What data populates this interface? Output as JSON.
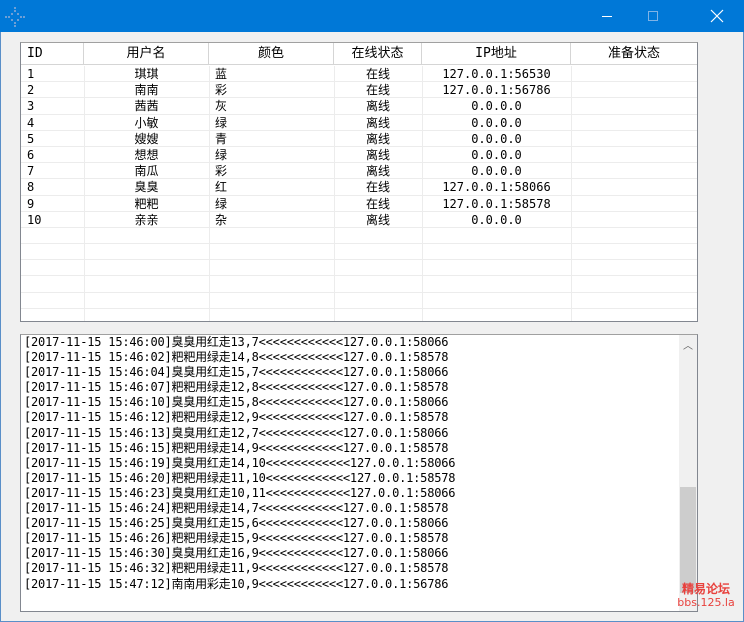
{
  "window": {
    "minimize_glyph": "—",
    "maximize_glyph": "☐",
    "close_glyph": "✕",
    "accent_color": "#0078d7"
  },
  "table": {
    "columns": [
      "ID",
      "用户名",
      "颜色",
      "在线状态",
      "IP地址",
      "准备状态"
    ],
    "rows": [
      {
        "id": "1",
        "user": "琪琪",
        "color": "蓝",
        "status": "在线",
        "ip": "127.0.0.1:56530",
        "ready": ""
      },
      {
        "id": "2",
        "user": "南南",
        "color": "彩",
        "status": "在线",
        "ip": "127.0.0.1:56786",
        "ready": ""
      },
      {
        "id": "3",
        "user": "茜茜",
        "color": "灰",
        "status": "离线",
        "ip": "0.0.0.0",
        "ready": ""
      },
      {
        "id": "4",
        "user": "小敏",
        "color": "绿",
        "status": "离线",
        "ip": "0.0.0.0",
        "ready": ""
      },
      {
        "id": "5",
        "user": "嫂嫂",
        "color": "青",
        "status": "离线",
        "ip": "0.0.0.0",
        "ready": ""
      },
      {
        "id": "6",
        "user": "想想",
        "color": "绿",
        "status": "离线",
        "ip": "0.0.0.0",
        "ready": ""
      },
      {
        "id": "7",
        "user": "南瓜",
        "color": "彩",
        "status": "离线",
        "ip": "0.0.0.0",
        "ready": ""
      },
      {
        "id": "8",
        "user": "臭臭",
        "color": "红",
        "status": "在线",
        "ip": "127.0.0.1:58066",
        "ready": ""
      },
      {
        "id": "9",
        "user": "粑粑",
        "color": "绿",
        "status": "在线",
        "ip": "127.0.0.1:58578",
        "ready": ""
      },
      {
        "id": "10",
        "user": "亲亲",
        "color": "杂",
        "status": "离线",
        "ip": "0.0.0.0",
        "ready": ""
      }
    ]
  },
  "log": {
    "lines": [
      "[2017-11-15 15:46:00]臭臭用红走13,7<<<<<<<<<<<<127.0.0.1:58066",
      "[2017-11-15 15:46:02]粑粑用绿走14,8<<<<<<<<<<<<127.0.0.1:58578",
      "[2017-11-15 15:46:04]臭臭用红走15,7<<<<<<<<<<<<127.0.0.1:58066",
      "[2017-11-15 15:46:07]粑粑用绿走12,8<<<<<<<<<<<<127.0.0.1:58578",
      "[2017-11-15 15:46:10]臭臭用红走15,8<<<<<<<<<<<<127.0.0.1:58066",
      "[2017-11-15 15:46:12]粑粑用绿走12,9<<<<<<<<<<<<127.0.0.1:58578",
      "[2017-11-15 15:46:13]臭臭用红走12,7<<<<<<<<<<<<127.0.0.1:58066",
      "[2017-11-15 15:46:15]粑粑用绿走14,9<<<<<<<<<<<<127.0.0.1:58578",
      "[2017-11-15 15:46:19]臭臭用红走14,10<<<<<<<<<<<<127.0.0.1:58066",
      "[2017-11-15 15:46:20]粑粑用绿走11,10<<<<<<<<<<<<127.0.0.1:58578",
      "[2017-11-15 15:46:23]臭臭用红走10,11<<<<<<<<<<<<127.0.0.1:58066",
      "[2017-11-15 15:46:24]粑粑用绿走14,7<<<<<<<<<<<<127.0.0.1:58578",
      "[2017-11-15 15:46:25]臭臭用红走15,6<<<<<<<<<<<<127.0.0.1:58066",
      "[2017-11-15 15:46:26]粑粑用绿走15,9<<<<<<<<<<<<127.0.0.1:58578",
      "[2017-11-15 15:46:30]臭臭用红走16,9<<<<<<<<<<<<127.0.0.1:58066",
      "[2017-11-15 15:46:32]粑粑用绿走11,9<<<<<<<<<<<<127.0.0.1:58578",
      "[2017-11-15 15:47:12]南南用彩走10,9<<<<<<<<<<<<127.0.0.1:56786"
    ],
    "scroll_up_glyph": "︿"
  },
  "watermark": {
    "title": "精易论坛",
    "url": "bbs.125.la",
    "color": "#e8413d"
  }
}
